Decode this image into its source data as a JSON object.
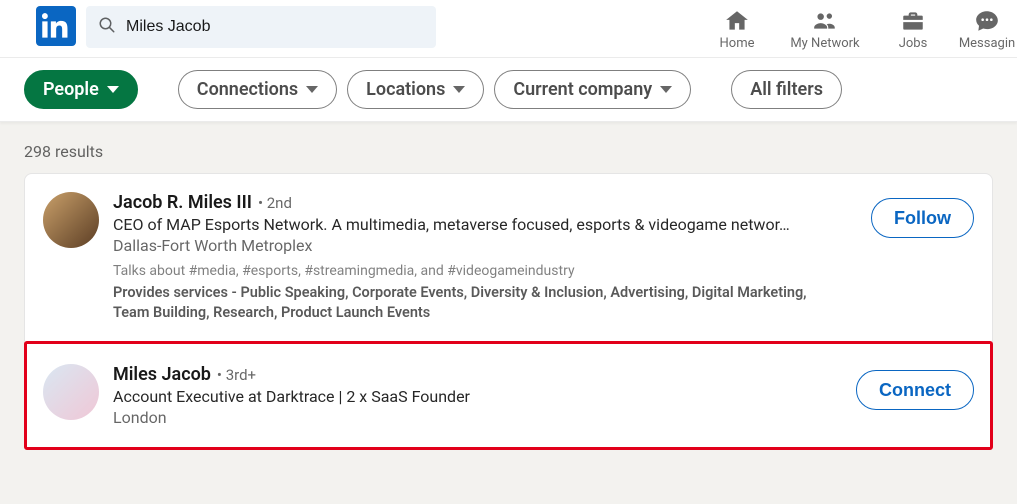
{
  "search": {
    "value": "Miles Jacob"
  },
  "nav": {
    "home": "Home",
    "network": "My Network",
    "jobs": "Jobs",
    "messaging": "Messagin"
  },
  "filters": {
    "active": "People",
    "connections": "Connections",
    "locations": "Locations",
    "company": "Current company",
    "all": "All filters"
  },
  "results_label": "298 results",
  "results": [
    {
      "name": "Jacob R. Miles III",
      "degree": "2nd",
      "headline": "CEO of MAP Esports Network. A multimedia, metaverse focused, esports & videogame networ…",
      "location": "Dallas-Fort Worth Metroplex",
      "talks": "Talks about #media, #esports, #streamingmedia, and #videogameindustry",
      "services": "Provides services - Public Speaking, Corporate Events, Diversity & Inclusion, Advertising, Digital Marketing, Team Building, Research, Product Launch Events",
      "action": "Follow"
    },
    {
      "name": "Miles Jacob",
      "degree": "3rd+",
      "headline": "Account Executive at Darktrace | 2 x SaaS Founder",
      "location": "London",
      "action": "Connect"
    }
  ]
}
